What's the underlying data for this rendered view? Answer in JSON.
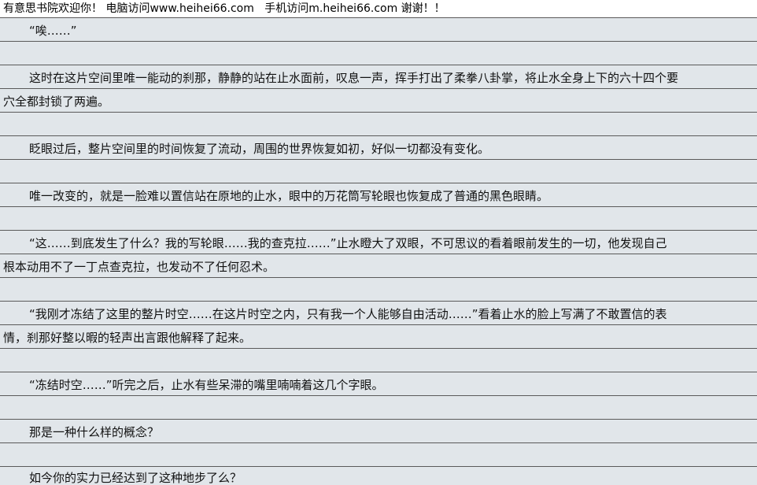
{
  "banner": {
    "text": "有意思书院欢迎你！ 电脑访问www.heihei66.com   手机访问m.heihei66.com 谢谢！！"
  },
  "article": {
    "lines": [
      "“唉……”",
      "这时在这片空间里唯一能动的刹那，静静的站在止水面前，叹息一声，挥手打出了柔拳八卦掌，将止水全身上下的六十四个要",
      "穴全都封锁了两遍。",
      "眨眼过后，整片空间里的时间恢复了流动，周围的世界恢复如初，好似一切都没有变化。",
      "唯一改变的，就是一脸难以置信站在原地的止水，眼中的万花筒写轮眼也恢复成了普通的黑色眼睛。",
      "“这……到底发生了什么？我的写轮眼……我的查克拉……”止水瞪大了双眼，不可思议的看着眼前发生的一切，他发现自己",
      "根本动用不了一丁点查克拉，也发动不了任何忍术。",
      "“我刚才冻结了这里的整片时空……在这片时空之内，只有我一个人能够自由活动……”看着止水的脸上写满了不敢置信的表",
      "情，刹那好整以暇的轻声出言跟他解释了起来。",
      "“冻结时空……”听完之后，止水有些呆滞的嘴里喃喃着这几个字眼。",
      "那是一种什么样的概念？",
      "如今你的实力已经达到了这种地步了么？"
    ]
  }
}
